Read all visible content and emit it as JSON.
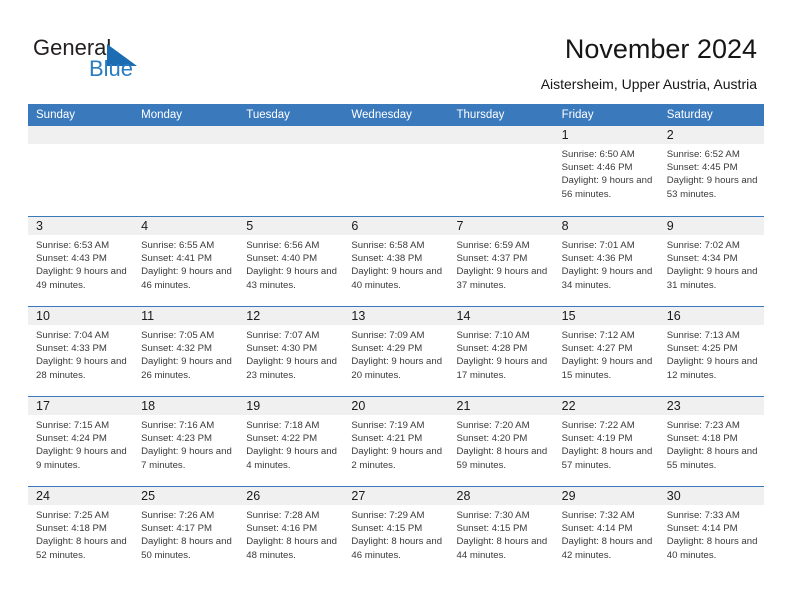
{
  "brand": {
    "name_part1": "General",
    "name_part2": "Blue",
    "accent_color": "#2b7cc0"
  },
  "header": {
    "title": "November 2024",
    "subtitle": "Aistersheim, Upper Austria, Austria"
  },
  "calendar": {
    "header_bg": "#3b79bd",
    "weekdays": [
      "Sunday",
      "Monday",
      "Tuesday",
      "Wednesday",
      "Thursday",
      "Friday",
      "Saturday"
    ],
    "weeks": [
      [
        {
          "day": "",
          "empty": true
        },
        {
          "day": "",
          "empty": true
        },
        {
          "day": "",
          "empty": true
        },
        {
          "day": "",
          "empty": true
        },
        {
          "day": "",
          "empty": true
        },
        {
          "day": "1",
          "sunrise": "Sunrise: 6:50 AM",
          "sunset": "Sunset: 4:46 PM",
          "daylight": "Daylight: 9 hours and 56 minutes."
        },
        {
          "day": "2",
          "sunrise": "Sunrise: 6:52 AM",
          "sunset": "Sunset: 4:45 PM",
          "daylight": "Daylight: 9 hours and 53 minutes."
        }
      ],
      [
        {
          "day": "3",
          "sunrise": "Sunrise: 6:53 AM",
          "sunset": "Sunset: 4:43 PM",
          "daylight": "Daylight: 9 hours and 49 minutes."
        },
        {
          "day": "4",
          "sunrise": "Sunrise: 6:55 AM",
          "sunset": "Sunset: 4:41 PM",
          "daylight": "Daylight: 9 hours and 46 minutes."
        },
        {
          "day": "5",
          "sunrise": "Sunrise: 6:56 AM",
          "sunset": "Sunset: 4:40 PM",
          "daylight": "Daylight: 9 hours and 43 minutes."
        },
        {
          "day": "6",
          "sunrise": "Sunrise: 6:58 AM",
          "sunset": "Sunset: 4:38 PM",
          "daylight": "Daylight: 9 hours and 40 minutes."
        },
        {
          "day": "7",
          "sunrise": "Sunrise: 6:59 AM",
          "sunset": "Sunset: 4:37 PM",
          "daylight": "Daylight: 9 hours and 37 minutes."
        },
        {
          "day": "8",
          "sunrise": "Sunrise: 7:01 AM",
          "sunset": "Sunset: 4:36 PM",
          "daylight": "Daylight: 9 hours and 34 minutes."
        },
        {
          "day": "9",
          "sunrise": "Sunrise: 7:02 AM",
          "sunset": "Sunset: 4:34 PM",
          "daylight": "Daylight: 9 hours and 31 minutes."
        }
      ],
      [
        {
          "day": "10",
          "sunrise": "Sunrise: 7:04 AM",
          "sunset": "Sunset: 4:33 PM",
          "daylight": "Daylight: 9 hours and 28 minutes."
        },
        {
          "day": "11",
          "sunrise": "Sunrise: 7:05 AM",
          "sunset": "Sunset: 4:32 PM",
          "daylight": "Daylight: 9 hours and 26 minutes."
        },
        {
          "day": "12",
          "sunrise": "Sunrise: 7:07 AM",
          "sunset": "Sunset: 4:30 PM",
          "daylight": "Daylight: 9 hours and 23 minutes."
        },
        {
          "day": "13",
          "sunrise": "Sunrise: 7:09 AM",
          "sunset": "Sunset: 4:29 PM",
          "daylight": "Daylight: 9 hours and 20 minutes."
        },
        {
          "day": "14",
          "sunrise": "Sunrise: 7:10 AM",
          "sunset": "Sunset: 4:28 PM",
          "daylight": "Daylight: 9 hours and 17 minutes."
        },
        {
          "day": "15",
          "sunrise": "Sunrise: 7:12 AM",
          "sunset": "Sunset: 4:27 PM",
          "daylight": "Daylight: 9 hours and 15 minutes."
        },
        {
          "day": "16",
          "sunrise": "Sunrise: 7:13 AM",
          "sunset": "Sunset: 4:25 PM",
          "daylight": "Daylight: 9 hours and 12 minutes."
        }
      ],
      [
        {
          "day": "17",
          "sunrise": "Sunrise: 7:15 AM",
          "sunset": "Sunset: 4:24 PM",
          "daylight": "Daylight: 9 hours and 9 minutes."
        },
        {
          "day": "18",
          "sunrise": "Sunrise: 7:16 AM",
          "sunset": "Sunset: 4:23 PM",
          "daylight": "Daylight: 9 hours and 7 minutes."
        },
        {
          "day": "19",
          "sunrise": "Sunrise: 7:18 AM",
          "sunset": "Sunset: 4:22 PM",
          "daylight": "Daylight: 9 hours and 4 minutes."
        },
        {
          "day": "20",
          "sunrise": "Sunrise: 7:19 AM",
          "sunset": "Sunset: 4:21 PM",
          "daylight": "Daylight: 9 hours and 2 minutes."
        },
        {
          "day": "21",
          "sunrise": "Sunrise: 7:20 AM",
          "sunset": "Sunset: 4:20 PM",
          "daylight": "Daylight: 8 hours and 59 minutes."
        },
        {
          "day": "22",
          "sunrise": "Sunrise: 7:22 AM",
          "sunset": "Sunset: 4:19 PM",
          "daylight": "Daylight: 8 hours and 57 minutes."
        },
        {
          "day": "23",
          "sunrise": "Sunrise: 7:23 AM",
          "sunset": "Sunset: 4:18 PM",
          "daylight": "Daylight: 8 hours and 55 minutes."
        }
      ],
      [
        {
          "day": "24",
          "sunrise": "Sunrise: 7:25 AM",
          "sunset": "Sunset: 4:18 PM",
          "daylight": "Daylight: 8 hours and 52 minutes."
        },
        {
          "day": "25",
          "sunrise": "Sunrise: 7:26 AM",
          "sunset": "Sunset: 4:17 PM",
          "daylight": "Daylight: 8 hours and 50 minutes."
        },
        {
          "day": "26",
          "sunrise": "Sunrise: 7:28 AM",
          "sunset": "Sunset: 4:16 PM",
          "daylight": "Daylight: 8 hours and 48 minutes."
        },
        {
          "day": "27",
          "sunrise": "Sunrise: 7:29 AM",
          "sunset": "Sunset: 4:15 PM",
          "daylight": "Daylight: 8 hours and 46 minutes."
        },
        {
          "day": "28",
          "sunrise": "Sunrise: 7:30 AM",
          "sunset": "Sunset: 4:15 PM",
          "daylight": "Daylight: 8 hours and 44 minutes."
        },
        {
          "day": "29",
          "sunrise": "Sunrise: 7:32 AM",
          "sunset": "Sunset: 4:14 PM",
          "daylight": "Daylight: 8 hours and 42 minutes."
        },
        {
          "day": "30",
          "sunrise": "Sunrise: 7:33 AM",
          "sunset": "Sunset: 4:14 PM",
          "daylight": "Daylight: 8 hours and 40 minutes."
        }
      ]
    ]
  }
}
